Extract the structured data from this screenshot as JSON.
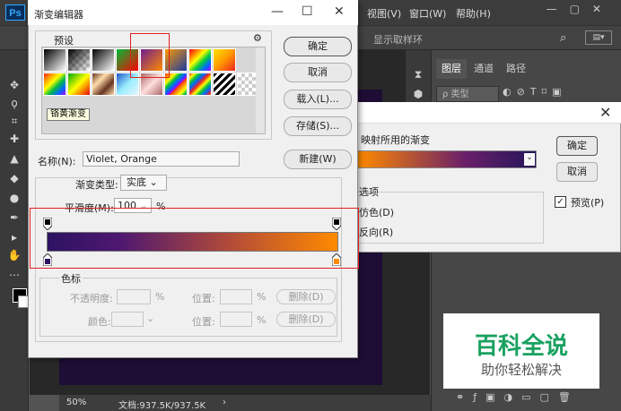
{
  "photoshop": {
    "logo": "Ps",
    "menus": [
      "视图(V)",
      "窗口(W)",
      "帮助(H)"
    ],
    "options_bar_text": "显示取样环",
    "status": {
      "zoom": "50%",
      "doc_info": "文档:937.5K/937.5K"
    },
    "layers_tabs": [
      "图层",
      "通道",
      "路径"
    ],
    "layer_filter": "ρ 类型",
    "tool_icons": [
      "move-icon",
      "lasso-icon",
      "crop-icon",
      "heal-icon",
      "stamp-icon",
      "eraser-icon",
      "blur-icon",
      "pen-icon",
      "select-icon",
      "hand-icon",
      "more-icon"
    ]
  },
  "gradient_map": {
    "label": "映射所用的渐变",
    "options_label": "选项",
    "option1": "仿色(D)",
    "option2": "反向(R)",
    "ok": "确定",
    "cancel": "取消",
    "preview": "预览(P)",
    "preview_checked": true
  },
  "gradient_editor": {
    "title": "渐变编辑器",
    "presets_label": "预设",
    "tooltip": "铬黄渐变",
    "buttons": {
      "ok": "确定",
      "cancel": "取消",
      "load": "载入(L)...",
      "save": "存储(S)...",
      "new": "新建(W)"
    },
    "name_label": "名称(N):",
    "name_value": "Violet, Orange",
    "gradient_type_label": "渐变类型:",
    "gradient_type_value": "实底",
    "smoothness_label": "平滑度(M):",
    "smoothness_value": "100",
    "smoothness_unit": "%",
    "stops_label": "色标",
    "opacity_label": "不透明度:",
    "location_label": "位置:",
    "delete_label": "删除(D)",
    "color_label": "颜色:",
    "percent": "%",
    "start_color": "#2d1362",
    "end_color": "#ff8a00"
  },
  "watermark": {
    "title": "百科全说",
    "subtitle": "助你轻松解决"
  }
}
